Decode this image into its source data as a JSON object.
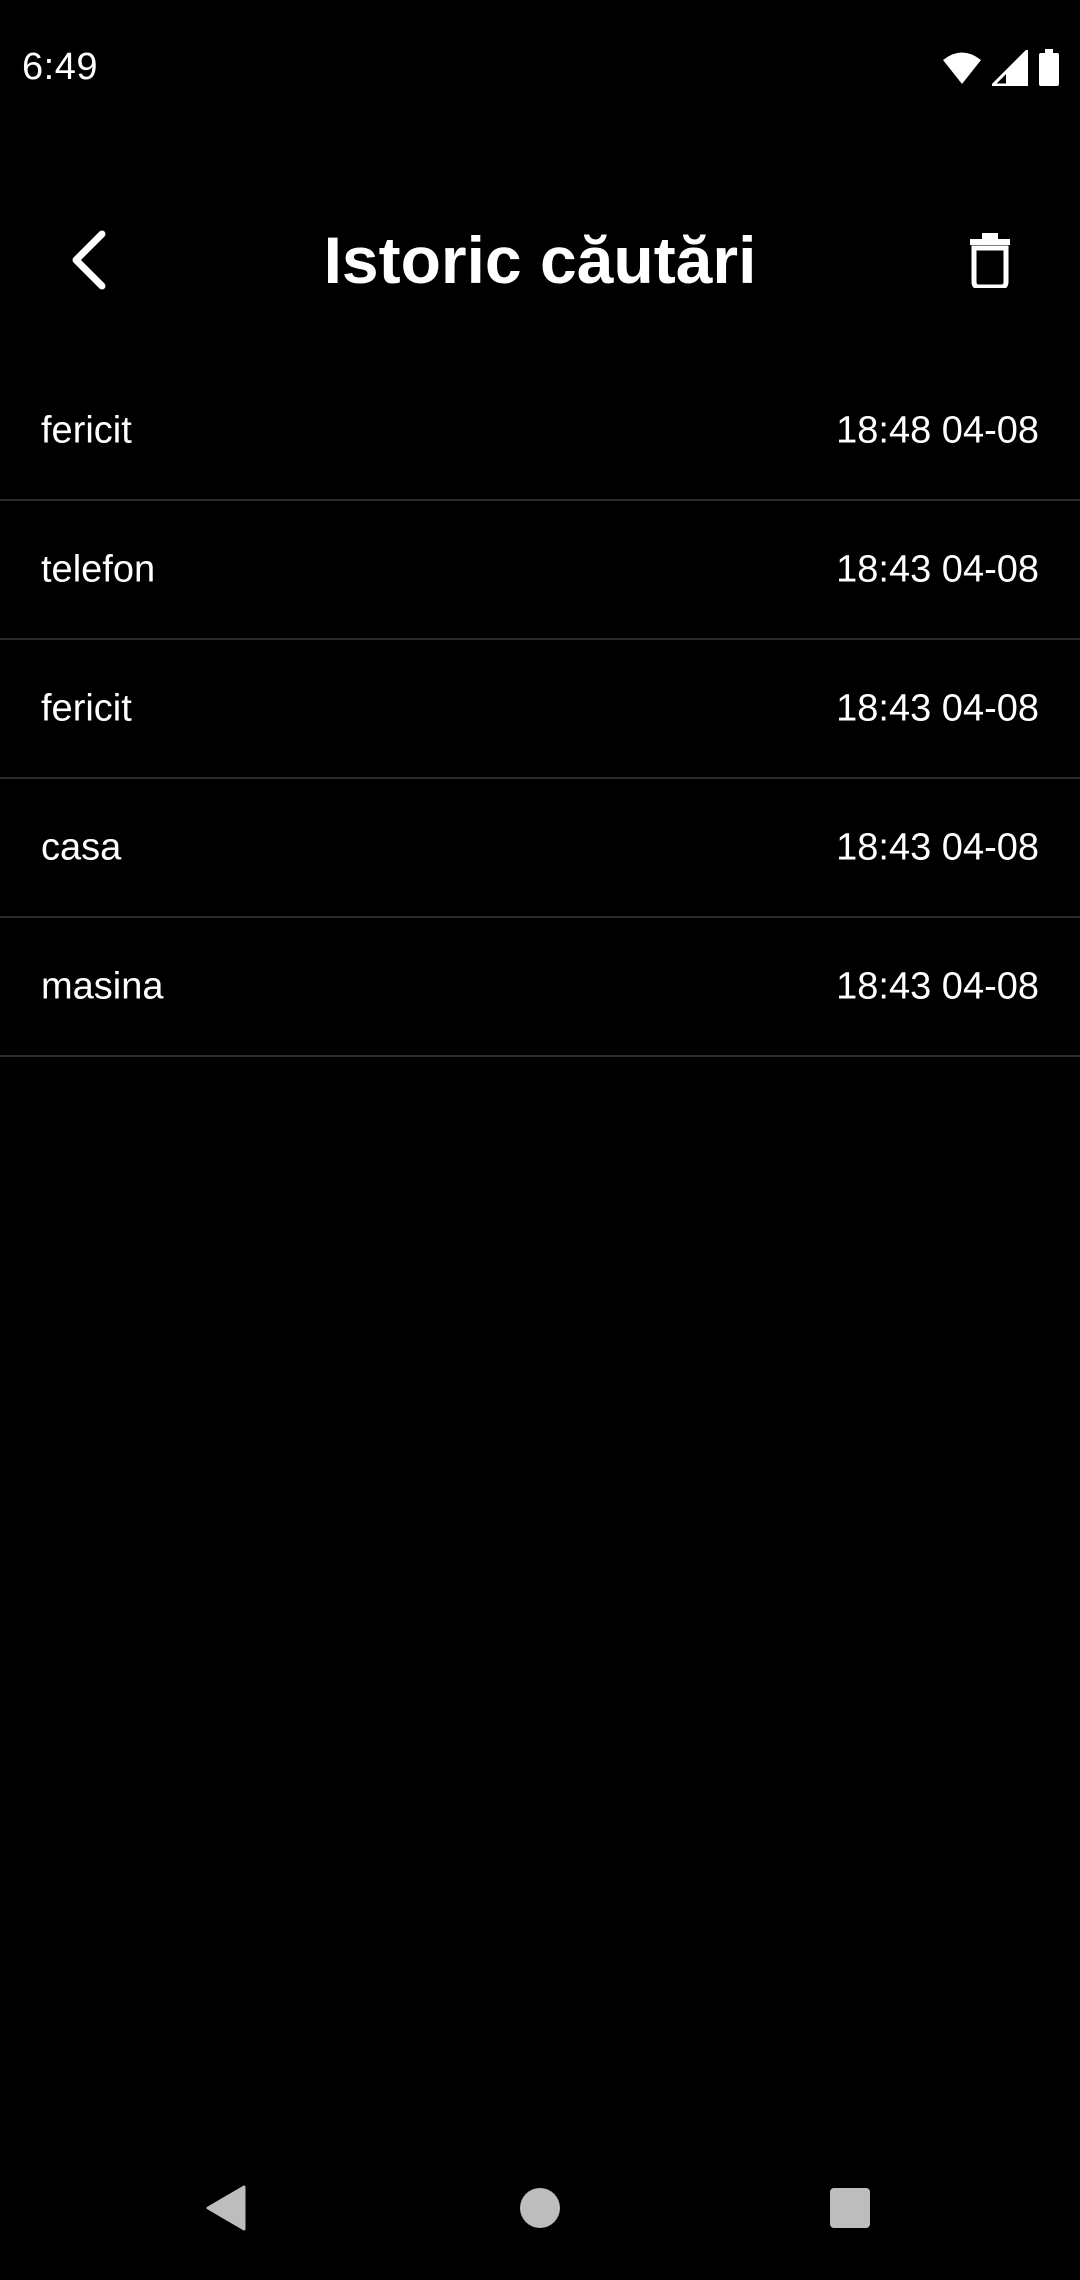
{
  "status_bar": {
    "time": "6:49",
    "icons": [
      "wifi-icon",
      "cellular-signal-icon",
      "battery-icon"
    ]
  },
  "app_bar": {
    "title": "Istoric căutări",
    "back_icon": "chevron-left-icon",
    "delete_icon": "trash-icon"
  },
  "history": {
    "items": [
      {
        "term": "fericit",
        "time": "18:48 04-08"
      },
      {
        "term": "telefon",
        "time": "18:43 04-08"
      },
      {
        "term": "fericit",
        "time": "18:43 04-08"
      },
      {
        "term": "casa",
        "time": "18:43 04-08"
      },
      {
        "term": "masina",
        "time": "18:43 04-08"
      }
    ]
  },
  "nav_bar": {
    "icons": [
      "back-triangle-icon",
      "home-circle-icon",
      "recents-square-icon"
    ]
  },
  "colors": {
    "background": "#000000",
    "text": "#ffffff",
    "divider": "#2b2b2b",
    "nav_icon": "#bdbdbd"
  }
}
